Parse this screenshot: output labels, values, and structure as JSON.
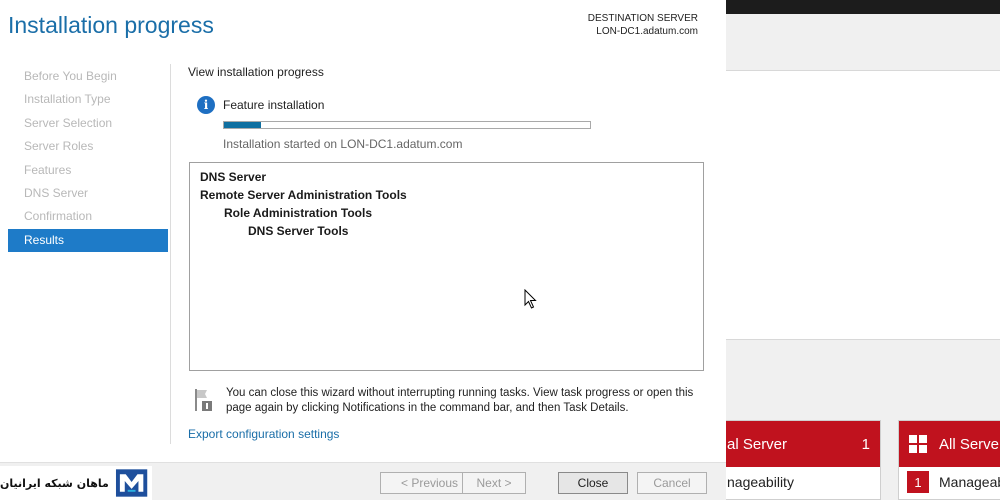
{
  "wizard": {
    "title": "Installation progress",
    "destination_label": "DESTINATION SERVER",
    "destination_server": "LON-DC1.adatum.com",
    "nav_items": [
      {
        "label": "Before You Begin",
        "active": false
      },
      {
        "label": "Installation Type",
        "active": false
      },
      {
        "label": "Server Selection",
        "active": false
      },
      {
        "label": "Server Roles",
        "active": false
      },
      {
        "label": "Features",
        "active": false
      },
      {
        "label": "DNS Server",
        "active": false
      },
      {
        "label": "Confirmation",
        "active": false
      },
      {
        "label": "Results",
        "active": true
      }
    ],
    "section_label": "View installation progress",
    "feature_label": "Feature installation",
    "progress_fraction": 0.1,
    "started_text": "Installation started on LON-DC1.adatum.com",
    "results": [
      {
        "label": "DNS Server",
        "level": 0
      },
      {
        "label": "Remote Server Administration Tools",
        "level": 0
      },
      {
        "label": "Role Administration Tools",
        "level": 1
      },
      {
        "label": "DNS Server Tools",
        "level": 2
      }
    ],
    "note": "You can close this wizard without interrupting running tasks. View task progress or open this page again by clicking Notifications in the command bar, and then Task Details.",
    "export_link": "Export configuration settings",
    "buttons": {
      "previous": "< Previous",
      "next": "Next >",
      "close": "Close",
      "cancel": "Cancel"
    }
  },
  "background": {
    "local_server_tile": {
      "title": "al Server",
      "count": "1",
      "row": "nageability"
    },
    "all_servers_tile": {
      "title": "All Server",
      "badge": "1",
      "row": "Manageab"
    }
  },
  "watermark": {
    "text": "ماهان شبکه ایرانیان"
  },
  "colors": {
    "title_blue": "#1a6ea8",
    "nav_active": "#1e7bc8",
    "progress_fill": "#0f6fa0",
    "tile_red": "#c0121e"
  }
}
